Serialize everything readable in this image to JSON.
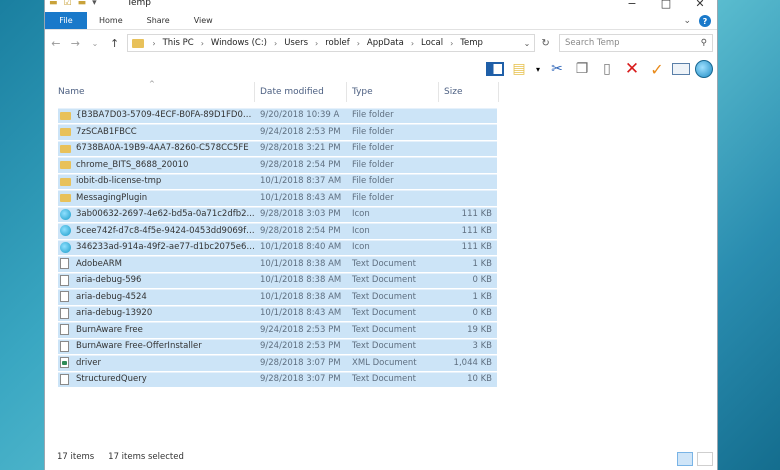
{
  "window": {
    "title": "Temp"
  },
  "ribbon": {
    "tabs": [
      {
        "label": "File"
      },
      {
        "label": "Home"
      },
      {
        "label": "Share"
      },
      {
        "label": "View"
      }
    ]
  },
  "address": {
    "crumbs": [
      "This PC",
      "Windows (C:)",
      "Users",
      "roblef",
      "AppData",
      "Local",
      "Temp"
    ],
    "search_placeholder": "Search Temp"
  },
  "columns": {
    "name": "Name",
    "date": "Date modified",
    "type": "Type",
    "size": "Size"
  },
  "files": [
    {
      "name": "{B3BA7D03-5709-4ECF-B0FA-89D1FD00...",
      "date": "9/20/2018 10:39 A",
      "type": "File folder",
      "size": "",
      "icon": "folder"
    },
    {
      "name": "7zSCAB1FBCC",
      "date": "9/24/2018 2:53 PM",
      "type": "File folder",
      "size": "",
      "icon": "folder"
    },
    {
      "name": "6738BA0A-19B9-4AA7-8260-C578CC5FE",
      "date": "9/28/2018 3:21 PM",
      "type": "File folder",
      "size": "",
      "icon": "folder"
    },
    {
      "name": "chrome_BITS_8688_20010",
      "date": "9/28/2018 2:54 PM",
      "type": "File folder",
      "size": "",
      "icon": "folder"
    },
    {
      "name": "iobit-db-license-tmp",
      "date": "10/1/2018 8:37 AM",
      "type": "File folder",
      "size": "",
      "icon": "folder"
    },
    {
      "name": "MessagingPlugin",
      "date": "10/1/2018 8:43 AM",
      "type": "File folder",
      "size": "",
      "icon": "folder"
    },
    {
      "name": "3ab00632-2697-4e62-bd5a-0a71c2dfb2...",
      "date": "9/28/2018 3:03 PM",
      "type": "Icon",
      "size": "111 KB",
      "icon": "icon"
    },
    {
      "name": "5cee742f-d7c8-4f5e-9424-0453dd9069f8...",
      "date": "9/28/2018 2:54 PM",
      "type": "Icon",
      "size": "111 KB",
      "icon": "icon"
    },
    {
      "name": "346233ad-914a-49f2-ae77-d1bc2075e69...",
      "date": "10/1/2018 8:40 AM",
      "type": "Icon",
      "size": "111 KB",
      "icon": "icon"
    },
    {
      "name": "AdobeARM",
      "date": "10/1/2018 8:38 AM",
      "type": "Text Document",
      "size": "1 KB",
      "icon": "text"
    },
    {
      "name": "aria-debug-596",
      "date": "10/1/2018 8:38 AM",
      "type": "Text Document",
      "size": "0 KB",
      "icon": "text"
    },
    {
      "name": "aria-debug-4524",
      "date": "10/1/2018 8:38 AM",
      "type": "Text Document",
      "size": "1 KB",
      "icon": "text"
    },
    {
      "name": "aria-debug-13920",
      "date": "10/1/2018 8:43 AM",
      "type": "Text Document",
      "size": "0 KB",
      "icon": "text"
    },
    {
      "name": "BurnAware Free",
      "date": "9/24/2018 2:53 PM",
      "type": "Text Document",
      "size": "19 KB",
      "icon": "text"
    },
    {
      "name": "BurnAware Free-OfferInstaller",
      "date": "9/24/2018 2:53 PM",
      "type": "Text Document",
      "size": "3 KB",
      "icon": "text"
    },
    {
      "name": "driver",
      "date": "9/28/2018 3:07 PM",
      "type": "XML Document",
      "size": "1,044 KB",
      "icon": "xml"
    },
    {
      "name": "StructuredQuery",
      "date": "9/28/2018 3:07 PM",
      "type": "Text Document",
      "size": "10 KB",
      "icon": "text"
    }
  ],
  "status": {
    "count": "17 items",
    "selected": "17 items selected"
  },
  "colors": {
    "accent": "#1979ca",
    "selection": "#cce4f7",
    "folder": "#e8c15a"
  }
}
